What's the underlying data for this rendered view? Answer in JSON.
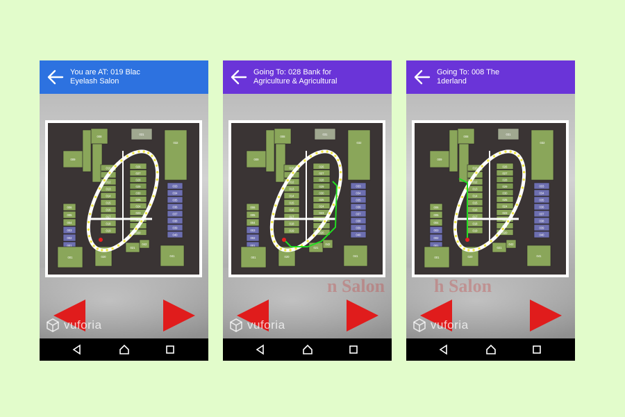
{
  "screens": [
    {
      "bar_color": "#2d72e0",
      "title": "You are AT: 019 Blac\nEyelash Salon",
      "back_icon": "arrow-left-icon",
      "route": "none",
      "ghost_text": ""
    },
    {
      "bar_color": "#6a34d8",
      "title": "Going To: 028 Bank for\nAgriculture & Agricultural",
      "back_icon": "arrow-left-icon",
      "route": "to-028",
      "ghost_text": "n Salon"
    },
    {
      "bar_color": "#6a34d8",
      "title": "Going To: 008 The\n1derland",
      "back_icon": "arrow-left-icon",
      "route": "to-008",
      "ghost_text": "h Salon"
    }
  ],
  "watermark": "vuforia",
  "map_labels": {
    "top": [
      "008",
      "031",
      "032"
    ],
    "left": [
      "009",
      "019",
      "036"
    ],
    "center_col": [
      "010",
      "011",
      "012",
      "013",
      "014",
      "015",
      "016",
      "017",
      "018",
      "019"
    ],
    "right_col": [
      "026",
      "027",
      "028",
      "029",
      "030",
      "025",
      "024",
      "023",
      "022",
      "021",
      "020"
    ],
    "far_right": [
      "033",
      "034",
      "035",
      "036",
      "037",
      "038",
      "039",
      "040"
    ],
    "left_col": [
      "006",
      "005",
      "004",
      "003",
      "002",
      "001"
    ],
    "bottom": [
      "001",
      "020",
      "021",
      "042",
      "041"
    ]
  },
  "nav_icons": [
    "triangle-back-icon",
    "circle-home-icon",
    "square-recent-icon"
  ],
  "colors": {
    "route": "#22dd22",
    "marker": "#e82020",
    "arrow": "#e01c1c",
    "map_bg": "#3a3434",
    "green_shop": "#8aa65a",
    "blue_shop": "#6d6fb0"
  }
}
